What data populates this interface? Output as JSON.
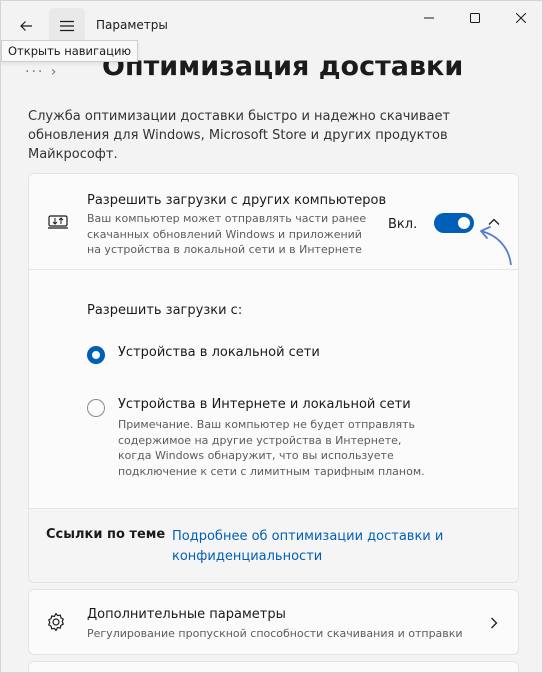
{
  "window": {
    "title": "Параметры",
    "tooltip": "Открыть навигацию"
  },
  "page": {
    "title": "Оптимизация доставки",
    "description": "Служба оптимизации доставки быстро и надежно скачивает обновления для Windows, Microsoft Store и других продуктов Майкрософт."
  },
  "allow_downloads": {
    "title": "Разрешить загрузки с других компьютеров",
    "description": "Ваш компьютер может отправлять части ранее скачанных обновлений Windows и приложений на устройства в локальной сети и в Интернете",
    "toggle_label": "Вкл.",
    "toggle_on": true,
    "from_label": "Разрешить загрузки с:",
    "options": [
      {
        "label": "Устройства в локальной сети",
        "selected": true,
        "note": ""
      },
      {
        "label": "Устройства в Интернете и локальной сети",
        "selected": false,
        "note": "Примечание. Ваш компьютер не будет отправлять содержимое на другие устройства в Интернете, когда Windows обнаружит, что вы используете подключение к сети с лимитным тарифным планом."
      }
    ]
  },
  "related": {
    "label": "Ссылки по теме",
    "link": "Подробнее об оптимизации доставки и конфиденциальности"
  },
  "advanced": {
    "title": "Дополнительные параметры",
    "description": "Регулирование пропускной способности скачивания и отправки"
  },
  "colors": {
    "accent": "#005fb8",
    "background": "#f3f3f3",
    "card": "#fbfbfb"
  }
}
